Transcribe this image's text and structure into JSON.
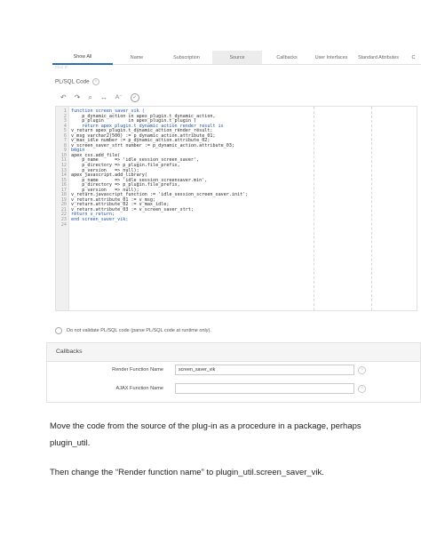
{
  "tabs": [
    "Show All",
    "Name",
    "Subscription",
    "Source",
    "Callbacks",
    "User Interfaces",
    "Standard Attributes",
    "C"
  ],
  "faint_text": "Shor th",
  "plsql_code_label": "PL/SQL Code",
  "help_glyph": "?",
  "toolbar": {
    "undo": "↶",
    "redo": "↷",
    "search": "⌕",
    "replace": "↔",
    "font": "A⁻",
    "validate": "✓"
  },
  "code_lines": [
    "function screen_saver_vik (",
    "    p_dynamic_action in apex_plugin.t_dynamic_action,",
    "    p_plugin         in apex_plugin.t_plugin )",
    "    return apex_plugin.t_dynamic_action_render_result is",
    "v_return apex_plugin.t_dynamic_action_render_result;",
    "v_msg varchar2(500) := p_dynamic_action.attribute_01;",
    "v_max_idle number := p_dynamic_action.attribute_02;",
    "v_screen_saver_strt number := p_dynamic_action.attribute_03;",
    "begin",
    "apex_css.add_file(",
    "    p_name      => 'idle_session_screen_saver',",
    "    p_directory => p_plugin.file_prefix,",
    "    p_version   => null);",
    "",
    "apex_javascript.add_library(",
    "    p_name      => 'idle_session_screensaver.min',",
    "    p_directory => p_plugin.file_prefix,",
    "    p_version   => null);",
    "v_return.javascript_function := 'idle_session_screen_saver.init';",
    "v_return.attribute_01 := v_msg;",
    "v_return.attribute_02 := v_max_idle;",
    "v_return.attribute_03 := v_screen_saver_strt;",
    "return v_return;",
    "end screen_saver_vik;"
  ],
  "checkbox_label": "Do not validate PL/SQL code (parse PL/SQL code at runtime only).",
  "callbacks": {
    "title": "Callbacks",
    "render_label": "Render Function Name",
    "render_value": "screen_saver_vik",
    "ajax_label": "AJAX Function Name",
    "ajax_value": ""
  },
  "paragraphs": [
    "Move the code from the source of the plug-in as a procedure in a package, perhaps",
    "plugin_util.",
    "Then change the “Render function name” to plugin_util.screen_saver_vik."
  ]
}
